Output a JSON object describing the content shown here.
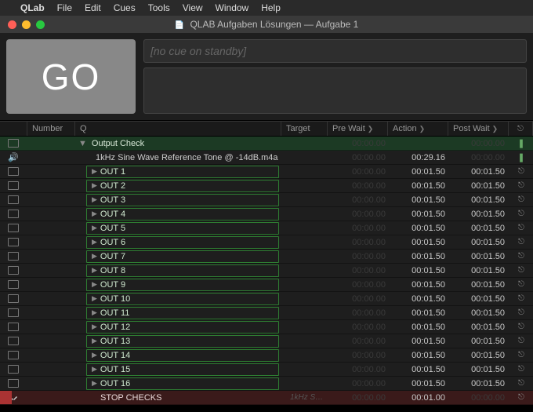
{
  "menubar": {
    "apple": "",
    "app": "QLab",
    "items": [
      "File",
      "Edit",
      "Cues",
      "Tools",
      "View",
      "Window",
      "Help"
    ]
  },
  "window": {
    "title": "QLAB Aufgaben Lösungen — Aufgabe 1"
  },
  "go": {
    "label": "GO"
  },
  "standby": {
    "placeholder": "[no cue on standby]"
  },
  "columns": {
    "number": "Number",
    "q": "Q",
    "target": "Target",
    "prewait": "Pre Wait",
    "action": "Action",
    "postwait": "Post Wait"
  },
  "group": {
    "name": "Output Check",
    "header_times": {
      "pre": "00:00.00",
      "act": "",
      "post": "00:00.00"
    },
    "sine": {
      "name": "1kHz Sine Wave Reference Tone @ -14dB.m4a",
      "times": {
        "pre": "00:00.00",
        "act": "00:29.16",
        "post": "00:00.00"
      }
    },
    "outs": [
      {
        "name": "OUT 1",
        "pre": "00:00.00",
        "act": "00:01.50",
        "post": "00:01.50"
      },
      {
        "name": "OUT 2",
        "pre": "00:00.00",
        "act": "00:01.50",
        "post": "00:01.50"
      },
      {
        "name": "OUT 3",
        "pre": "00:00.00",
        "act": "00:01.50",
        "post": "00:01.50"
      },
      {
        "name": "OUT 4",
        "pre": "00:00.00",
        "act": "00:01.50",
        "post": "00:01.50"
      },
      {
        "name": "OUT 5",
        "pre": "00:00.00",
        "act": "00:01.50",
        "post": "00:01.50"
      },
      {
        "name": "OUT 6",
        "pre": "00:00.00",
        "act": "00:01.50",
        "post": "00:01.50"
      },
      {
        "name": "OUT 7",
        "pre": "00:00.00",
        "act": "00:01.50",
        "post": "00:01.50"
      },
      {
        "name": "OUT 8",
        "pre": "00:00.00",
        "act": "00:01.50",
        "post": "00:01.50"
      },
      {
        "name": "OUT 9",
        "pre": "00:00.00",
        "act": "00:01.50",
        "post": "00:01.50"
      },
      {
        "name": "OUT 10",
        "pre": "00:00.00",
        "act": "00:01.50",
        "post": "00:01.50"
      },
      {
        "name": "OUT 11",
        "pre": "00:00.00",
        "act": "00:01.50",
        "post": "00:01.50"
      },
      {
        "name": "OUT 12",
        "pre": "00:00.00",
        "act": "00:01.50",
        "post": "00:01.50"
      },
      {
        "name": "OUT 13",
        "pre": "00:00.00",
        "act": "00:01.50",
        "post": "00:01.50"
      },
      {
        "name": "OUT 14",
        "pre": "00:00.00",
        "act": "00:01.50",
        "post": "00:01.50"
      },
      {
        "name": "OUT 15",
        "pre": "00:00.00",
        "act": "00:01.50",
        "post": "00:01.50"
      },
      {
        "name": "OUT 16",
        "pre": "00:00.00",
        "act": "00:01.50",
        "post": "00:01.50"
      }
    ],
    "stop": {
      "name": "STOP CHECKS",
      "target": "1kHz S…",
      "pre": "00:00.00",
      "act": "00:01.00",
      "post": "00:00.00"
    }
  },
  "icons": {
    "disc_down": "▼",
    "disc_right": "▶",
    "speaker": "🔊",
    "anchor": "⎋",
    "mic": "❘",
    "flag": "⚑"
  }
}
